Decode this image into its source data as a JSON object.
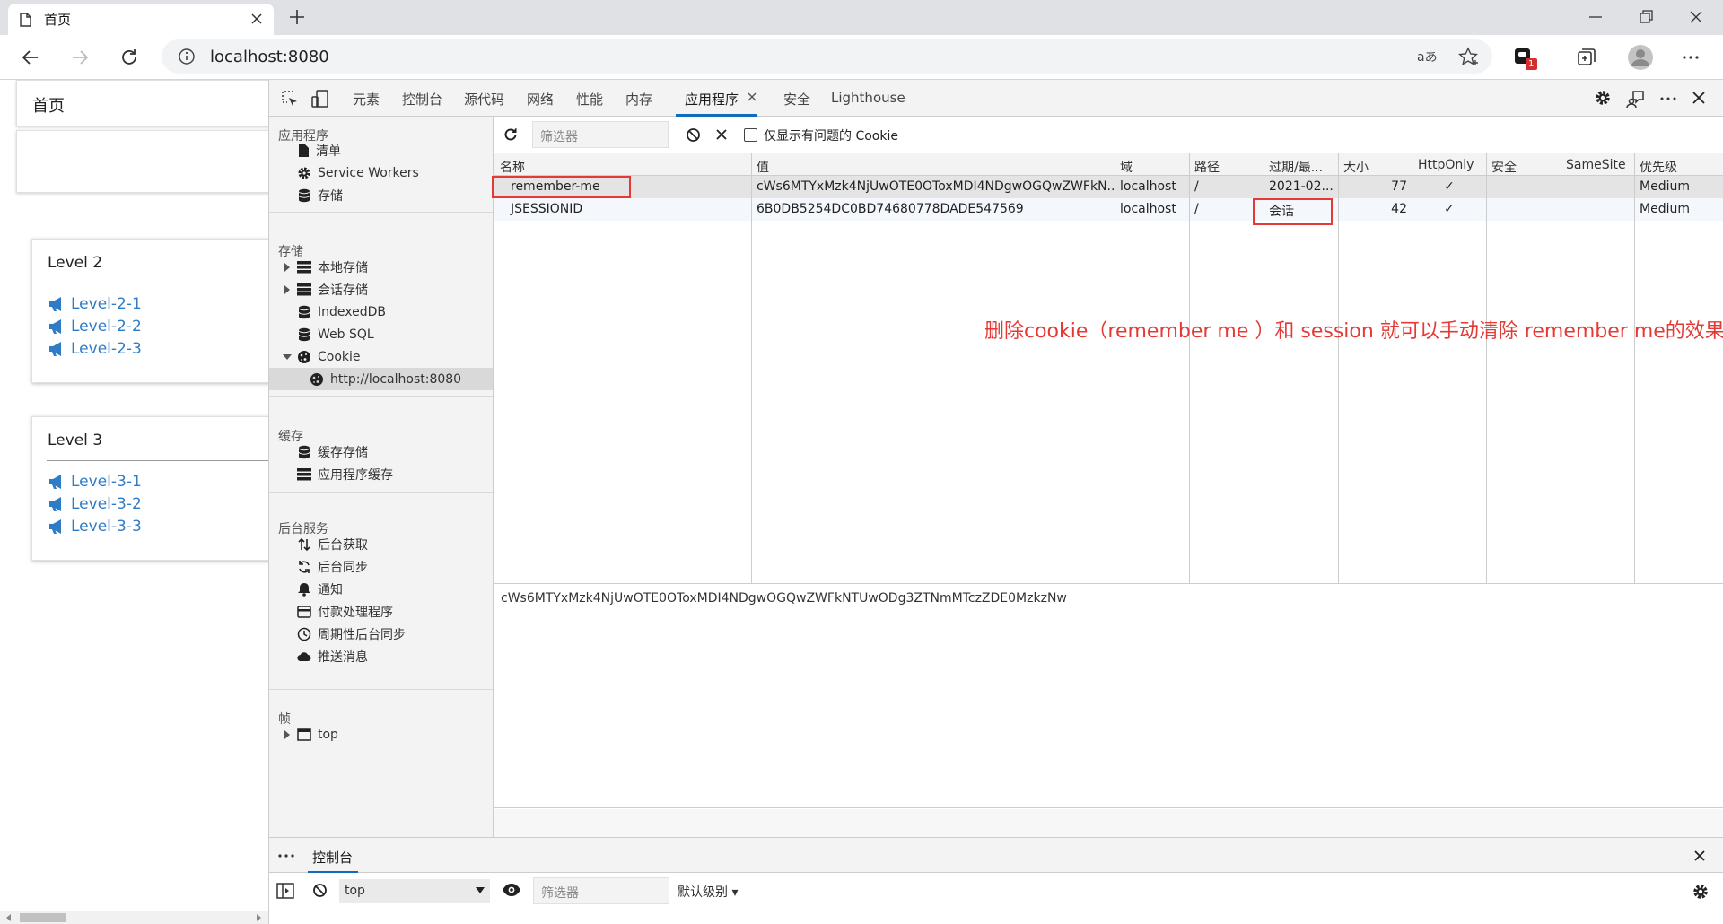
{
  "browser": {
    "tab_title": "首页",
    "url": "localhost:8080",
    "notification_badge": "1"
  },
  "page": {
    "nav_item": "首页",
    "cards": [
      {
        "title": "Level 2",
        "links": [
          "Level-2-1",
          "Level-2-2",
          "Level-2-3"
        ]
      },
      {
        "title": "Level 3",
        "links": [
          "Level-3-1",
          "Level-3-2",
          "Level-3-3"
        ]
      }
    ]
  },
  "devtools": {
    "tabs": [
      "元素",
      "控制台",
      "源代码",
      "网络",
      "性能",
      "内存",
      "应用程序",
      "安全",
      "Lighthouse"
    ],
    "active_tab": "应用程序",
    "sidebar": {
      "sections": [
        {
          "title": "应用程序",
          "items": [
            "清单",
            "Service Workers",
            "存储"
          ]
        },
        {
          "title": "存储",
          "items": [
            "本地存储",
            "会话存储",
            "IndexedDB",
            "Web SQL",
            "Cookie",
            "http://localhost:8080"
          ]
        },
        {
          "title": "缓存",
          "items": [
            "缓存存储",
            "应用程序缓存"
          ]
        },
        {
          "title": "后台服务",
          "items": [
            "后台获取",
            "后台同步",
            "通知",
            "付款处理程序",
            "周期性后台同步",
            "推送消息"
          ]
        },
        {
          "title": "帧",
          "items": [
            "top"
          ]
        }
      ]
    },
    "filter": {
      "placeholder": "筛选器",
      "checkbox_label": "仅显示有问题的 Cookie"
    },
    "cookie_table": {
      "columns": [
        "名称",
        "值",
        "域",
        "路径",
        "过期/最...",
        "大小",
        "HttpOnly",
        "安全",
        "SameSite",
        "优先级"
      ],
      "rows": [
        {
          "name": "remember-me",
          "value": "cWs6MTYxMzk4NjUwOTE0OToxMDI4NDgwOGQwZWFkN...",
          "domain": "localhost",
          "path": "/",
          "expires": "2021-02...",
          "size": "77",
          "httponly": "✓",
          "secure": "",
          "samesite": "",
          "priority": "Medium"
        },
        {
          "name": "JSESSIONID",
          "value": "6B0DB5254DC0BD74680778DADE547569",
          "domain": "localhost",
          "path": "/",
          "expires": "会话",
          "size": "42",
          "httponly": "✓",
          "secure": "",
          "samesite": "",
          "priority": "Medium"
        }
      ]
    },
    "annotation": "删除cookie（remember me ）和 session 就可以手动清除 remember me的效果",
    "preview_value": "cWs6MTYxMzk4NjUwOTE0OToxMDI4NDgwOGQwZWFkNTUwODg3ZTNmMTczZDE0MzkzNw",
    "drawer": {
      "tab": "控制台",
      "context": "top",
      "filter_placeholder": "筛选器",
      "levels": "默认级别 ▾"
    }
  },
  "colors": {
    "accent": "#0f6cbd",
    "link": "#2f7cc6",
    "annotation_red": "#e53935"
  }
}
